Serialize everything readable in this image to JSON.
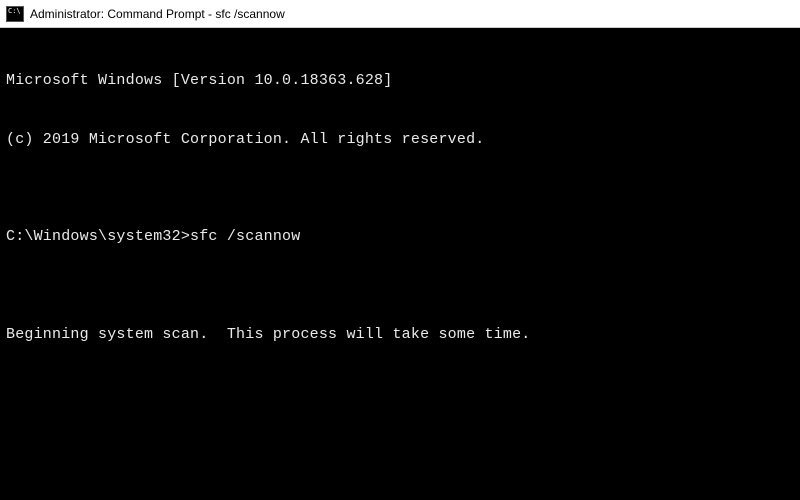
{
  "titlebar": {
    "title": "Administrator: Command Prompt - sfc  /scannow"
  },
  "terminal": {
    "line1": "Microsoft Windows [Version 10.0.18363.628]",
    "line2": "(c) 2019 Microsoft Corporation. All rights reserved.",
    "blank1": "",
    "prompt": "C:\\Windows\\system32>",
    "command": "sfc /scannow",
    "blank2": "",
    "status": "Beginning system scan.  This process will take some time."
  }
}
